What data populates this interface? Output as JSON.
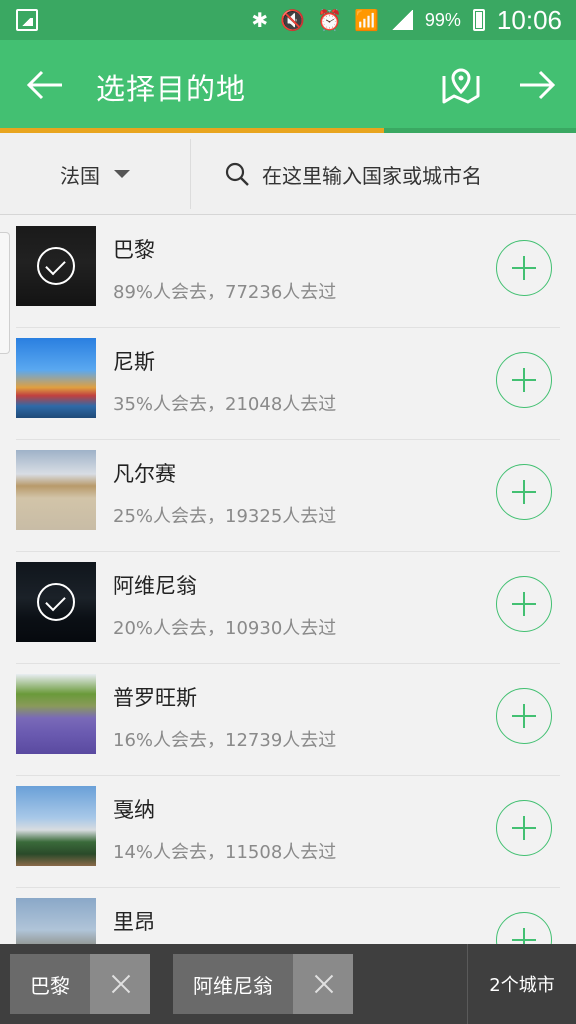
{
  "status_bar": {
    "battery": "99%",
    "time": "10:06",
    "icons": [
      "gallery-icon",
      "bluetooth-icon",
      "mute-icon",
      "alarm-icon",
      "wifi-icon",
      "signal-icon",
      "battery-icon"
    ]
  },
  "app_bar": {
    "title": "选择目的地",
    "back_icon": "arrow-left-icon",
    "map_icon": "map-pin-icon",
    "forward_icon": "arrow-right-icon"
  },
  "progress": {
    "fraction": 0.667,
    "color": "#e8a51f"
  },
  "filter": {
    "country": "法国",
    "search_placeholder": "在这里输入国家或城市名"
  },
  "cities": [
    {
      "name": "巴黎",
      "stats": "89%人会去，77236人去过",
      "selected": true
    },
    {
      "name": "尼斯",
      "stats": "35%人会去，21048人去过",
      "selected": false
    },
    {
      "name": "凡尔赛",
      "stats": "25%人会去，19325人去过",
      "selected": false
    },
    {
      "name": "阿维尼翁",
      "stats": "20%人会去，10930人去过",
      "selected": true
    },
    {
      "name": "普罗旺斯",
      "stats": "16%人会去，12739人去过",
      "selected": false
    },
    {
      "name": "戛纳",
      "stats": "14%人会去，11508人去过",
      "selected": false
    },
    {
      "name": "里昂",
      "stats": "",
      "selected": false
    }
  ],
  "bottom_bar": {
    "chips": [
      "巴黎",
      "阿维尼翁"
    ],
    "count": "2个城市"
  },
  "colors": {
    "status_bar": "#3aa862",
    "app_bar": "#43c072",
    "accent": "#43c072",
    "bottom_bar": "#3f3f3f"
  }
}
